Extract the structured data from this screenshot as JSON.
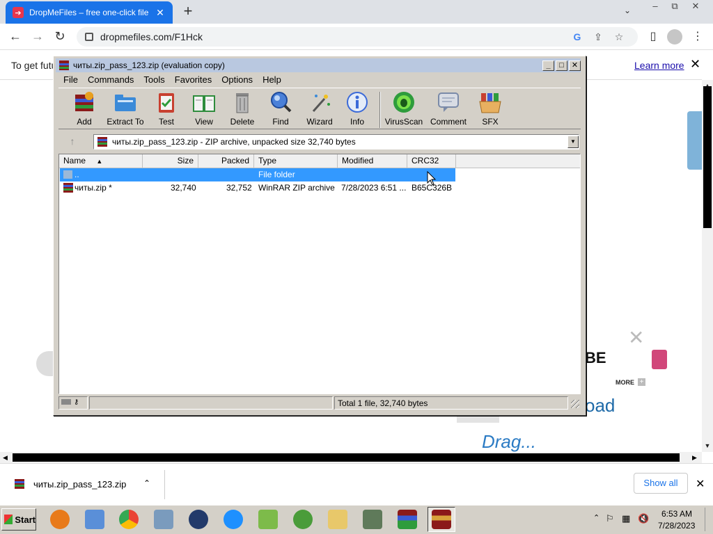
{
  "browser": {
    "tab_title": "DropMeFiles – free one-click file",
    "url": "dropmefiles.com/F1Hck",
    "new_tab": "+",
    "tab_close": "✕",
    "minimize": "–",
    "maximize": "⧉",
    "close": "✕"
  },
  "infobar": {
    "text": "To get futu",
    "learn_more": "Learn more",
    "close": "✕"
  },
  "page": {
    "close_glyph": "✕",
    "fragment_be": "BE",
    "more": "MORE",
    "more_plus": "+",
    "fragment_oad": "oad",
    "fragment_script": "Drag..."
  },
  "downloads": {
    "file_name": "читы.zip_pass_123.zip",
    "show_all": "Show all",
    "close": "✕"
  },
  "taskbar": {
    "start_label": "Start",
    "time": "6:53 AM",
    "date": "7/28/2023"
  },
  "winrar": {
    "title": "читы.zip_pass_123.zip (evaluation copy)",
    "menu": [
      "File",
      "Commands",
      "Tools",
      "Favorites",
      "Options",
      "Help"
    ],
    "tools": [
      "Add",
      "Extract To",
      "Test",
      "View",
      "Delete",
      "Find",
      "Wizard",
      "Info",
      "VirusScan",
      "Comment",
      "SFX"
    ],
    "address": "читы.zip_pass_123.zip - ZIP archive, unpacked size 32,740 bytes",
    "columns": [
      "Name",
      "Size",
      "Packed",
      "Type",
      "Modified",
      "CRC32"
    ],
    "rows": [
      {
        "name": "..",
        "size": "",
        "packed": "",
        "type": "File folder",
        "modified": "",
        "crc": ""
      },
      {
        "name": "читы.zip *",
        "size": "32,740",
        "packed": "32,752",
        "type": "WinRAR ZIP archive",
        "modified": "7/28/2023 6:51 ...",
        "crc": "B65C326B"
      }
    ],
    "status": "Total 1 file, 32,740 bytes"
  },
  "colors": {
    "chrome_tab": "#1a73e8",
    "selection": "#3399ff",
    "win_face": "#d4d0c8"
  }
}
